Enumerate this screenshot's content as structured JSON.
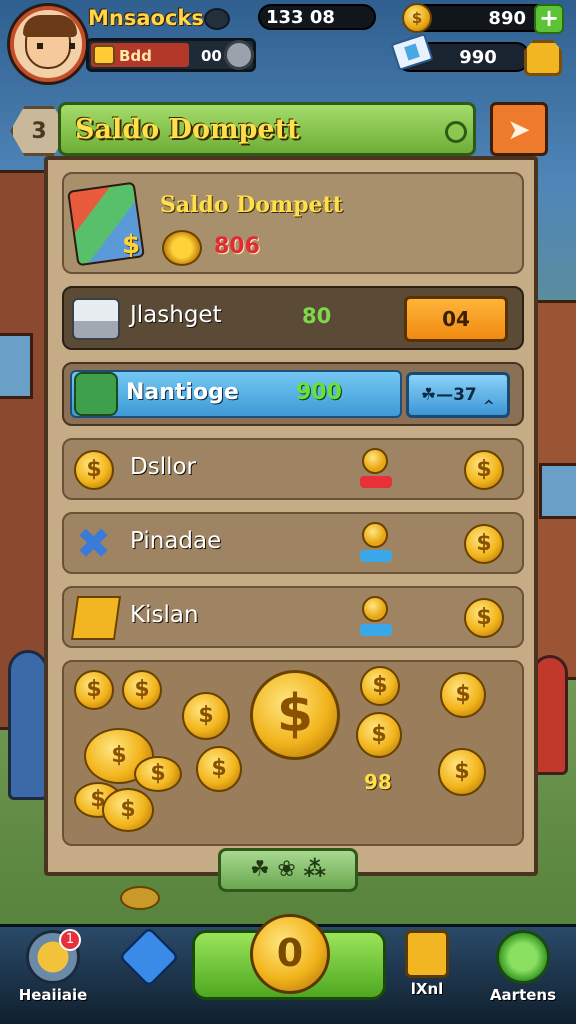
{
  "top_bar": {
    "player_name": "Mnsaocks",
    "level_label": "Bdd",
    "level_value": "00",
    "score": "133 08",
    "coins": "890",
    "gems": "990"
  },
  "panel": {
    "title": "Saldo Dompett",
    "balance_title": "Saldo Dompett",
    "balance_value": "806",
    "balance_icon": "$"
  },
  "rows": [
    {
      "label": "Jlashget",
      "amount": "80",
      "button": "04"
    },
    {
      "label": "Nantioge",
      "amount": "900",
      "button": "☘—37 ‸"
    },
    {
      "label": "Dsllor"
    },
    {
      "label": "Pinadae"
    },
    {
      "label": "Kislan"
    }
  ],
  "coin_pile": {
    "count": "98",
    "big_coin_symbol": "$"
  },
  "coin_symbol": "$",
  "paginator": {
    "label": "☘ ❀ ⁂"
  },
  "bottom_nav": {
    "left_label": "Heaiiaie",
    "left_badge": "1",
    "play_symbol": "0",
    "right1_label": "lXnl",
    "right2_label": "Aartens"
  },
  "icons": {
    "share": "➤",
    "hex": "3",
    "plus": "+",
    "x_mark": "✖"
  },
  "colors": {
    "header_green": "#6dae37",
    "title_yellow": "#ffe04a",
    "orange_button": "#f08a12",
    "blue_button": "#3e96d6",
    "panel_tan": "#c6ac86"
  }
}
